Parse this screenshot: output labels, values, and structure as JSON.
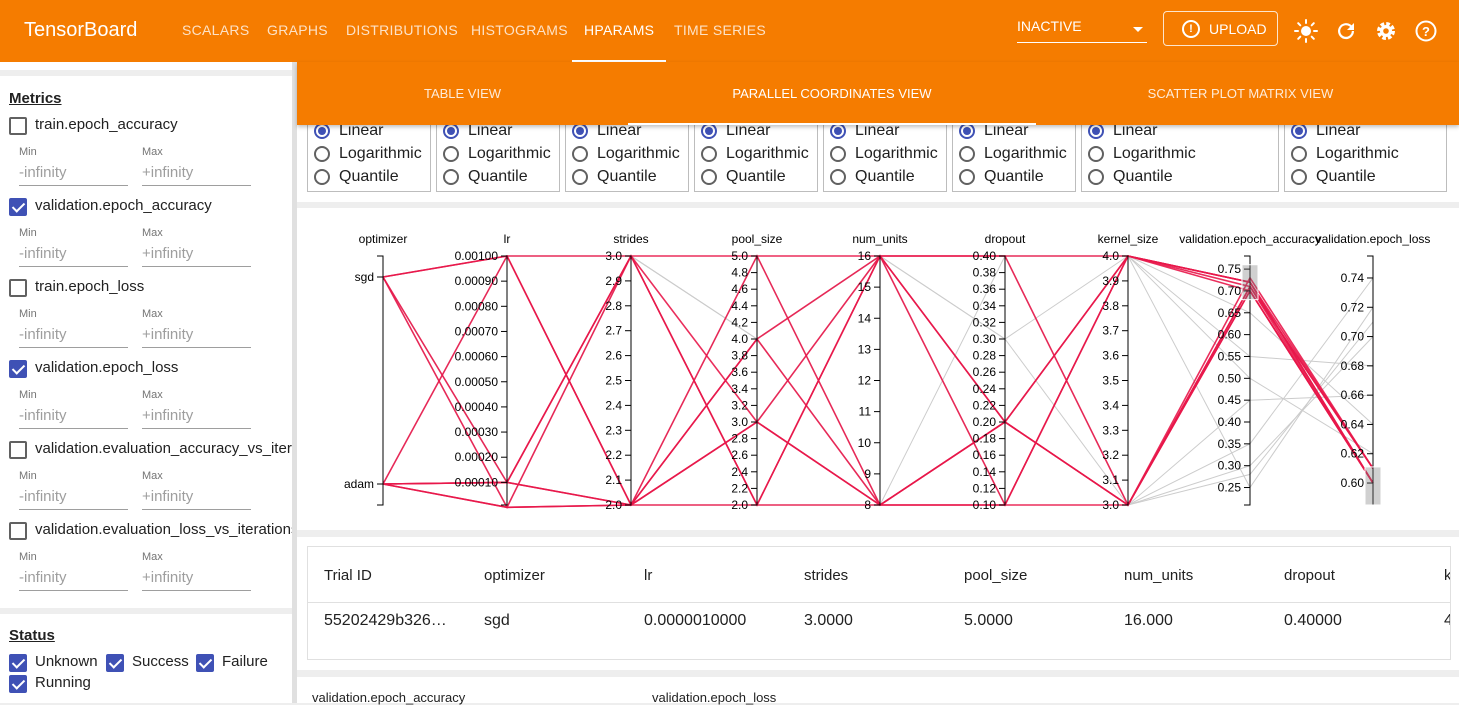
{
  "app": {
    "title": "TensorBoard",
    "nav": [
      "SCALARS",
      "GRAPHS",
      "DISTRIBUTIONS",
      "HISTOGRAMS",
      "HPARAMS",
      "TIME SERIES"
    ],
    "active_nav": "HPARAMS",
    "run_select": "INACTIVE",
    "upload_label": "UPLOAD",
    "toolbar_icons": [
      "brightness-icon",
      "refresh-icon",
      "settings-icon",
      "help-icon"
    ],
    "accent": "#f57c00"
  },
  "subtabs": [
    "TABLE VIEW",
    "PARALLEL COORDINATES VIEW",
    "SCATTER PLOT MATRIX VIEW"
  ],
  "active_subtab": "PARALLEL COORDINATES VIEW",
  "sidebar": {
    "metrics_title": "Metrics",
    "min_label": "Min",
    "max_label": "Max",
    "min_placeholder": "-infinity",
    "max_placeholder": "+infinity",
    "metrics": [
      {
        "label": "train.epoch_accuracy",
        "checked": false
      },
      {
        "label": "validation.epoch_accuracy",
        "checked": true
      },
      {
        "label": "train.epoch_loss",
        "checked": false
      },
      {
        "label": "validation.epoch_loss",
        "checked": true
      },
      {
        "label": "validation.evaluation_accuracy_vs_iterations",
        "checked": false
      },
      {
        "label": "validation.evaluation_loss_vs_iterations",
        "checked": false
      }
    ],
    "status_title": "Status",
    "statuses": [
      {
        "label": "Unknown",
        "checked": true
      },
      {
        "label": "Success",
        "checked": true
      },
      {
        "label": "Failure",
        "checked": true
      },
      {
        "label": "Running",
        "checked": true
      }
    ]
  },
  "scale_options": [
    "Linear",
    "Logarithmic",
    "Quantile"
  ],
  "selected_scale": "Linear",
  "chart_data": {
    "type": "parallel_coordinates",
    "axes": [
      {
        "name": "optimizer",
        "categorical": true,
        "ticks": [
          "sgd",
          "adam"
        ]
      },
      {
        "name": "lr",
        "ticks": [
          "0.00100",
          "0.00090",
          "0.00080",
          "0.00070",
          "0.00060",
          "0.00050",
          "0.00040",
          "0.00030",
          "0.00020",
          "0.00010"
        ],
        "range": [
          1e-05,
          0.001
        ]
      },
      {
        "name": "strides",
        "ticks": [
          "3.0",
          "2.9",
          "2.8",
          "2.7",
          "2.6",
          "2.5",
          "2.4",
          "2.3",
          "2.2",
          "2.1",
          "2.0"
        ],
        "range": [
          2,
          3
        ]
      },
      {
        "name": "pool_size",
        "ticks": [
          "5.0",
          "4.8",
          "4.6",
          "4.4",
          "4.2",
          "4.0",
          "3.8",
          "3.6",
          "3.4",
          "3.2",
          "3.0",
          "2.8",
          "2.6",
          "2.4",
          "2.2",
          "2.0"
        ],
        "range": [
          2,
          5
        ]
      },
      {
        "name": "num_units",
        "ticks": [
          "16",
          "15",
          "14",
          "13",
          "12",
          "11",
          "10",
          "9",
          "8"
        ],
        "range": [
          8,
          16
        ]
      },
      {
        "name": "dropout",
        "ticks": [
          "0.40",
          "0.38",
          "0.36",
          "0.34",
          "0.32",
          "0.30",
          "0.28",
          "0.26",
          "0.24",
          "0.22",
          "0.20",
          "0.18",
          "0.16",
          "0.14",
          "0.12",
          "0.10"
        ],
        "range": [
          0.1,
          0.4
        ]
      },
      {
        "name": "kernel_size",
        "ticks": [
          "4.0",
          "3.9",
          "3.8",
          "3.7",
          "3.6",
          "3.5",
          "3.4",
          "3.3",
          "3.2",
          "3.1",
          "3.0"
        ],
        "range": [
          3,
          4
        ]
      },
      {
        "name": "validation.epoch_accuracy",
        "ticks": [
          "0.75",
          "0.70",
          "0.65",
          "0.60",
          "0.55",
          "0.50",
          "0.45",
          "0.40",
          "0.35",
          "0.30",
          "0.25"
        ],
        "range": [
          0.21,
          0.78
        ]
      },
      {
        "name": "validation.epoch_loss",
        "ticks": [
          "0.74",
          "0.72",
          "0.70",
          "0.68",
          "0.66",
          "0.64",
          "0.62",
          "0.60"
        ],
        "range": [
          0.585,
          0.755
        ]
      }
    ],
    "highlighted_trials": [
      [
        "sgd",
        1e-06,
        3,
        5,
        16,
        0.4,
        4,
        0.71,
        0.61
      ],
      [
        "sgd",
        0.001,
        2,
        4,
        16,
        0.2,
        3,
        0.7,
        0.6
      ],
      [
        "adam",
        0.0001,
        3,
        3,
        8,
        0.1,
        4,
        0.72,
        0.6
      ],
      [
        "adam",
        0.0001,
        2,
        2,
        16,
        0.1,
        4,
        0.72,
        0.61
      ],
      [
        "adam",
        1e-06,
        2,
        4,
        8,
        0.2,
        3,
        0.71,
        0.6
      ],
      [
        "sgd",
        0.001,
        2,
        3,
        8,
        0.2,
        3,
        0.7,
        0.6
      ],
      [
        "adam",
        0.001,
        3,
        2,
        16,
        0.4,
        3,
        0.73,
        0.61
      ],
      [
        "sgd",
        0.0001,
        2,
        5,
        8,
        0.2,
        4,
        0.72,
        0.6
      ],
      [
        "adam",
        0.0001,
        3,
        2,
        8,
        0.1,
        3,
        0.71,
        0.61
      ],
      [
        "adam",
        1e-06,
        2,
        3,
        16,
        0.2,
        4,
        0.7,
        0.6
      ]
    ],
    "background_trials": [
      [
        "sgd",
        0.0001,
        3,
        4,
        16,
        0.3,
        3,
        0.3,
        0.7
      ],
      [
        "adam",
        1e-06,
        2,
        2,
        8,
        0.1,
        4,
        0.25,
        0.72
      ],
      [
        "sgd",
        0.001,
        3,
        4,
        16,
        0.4,
        4,
        0.55,
        0.68
      ],
      [
        "adam",
        0.0001,
        2,
        3,
        8,
        0.2,
        3,
        0.45,
        0.66
      ],
      [
        "sgd",
        1e-06,
        3,
        2,
        16,
        0.1,
        4,
        0.65,
        0.64
      ],
      [
        "adam",
        0.001,
        2,
        5,
        8,
        0.4,
        3,
        0.35,
        0.74
      ],
      [
        "sgd",
        0.0001,
        2,
        3,
        16,
        0.3,
        4,
        0.5,
        0.62
      ],
      [
        "adam",
        1e-06,
        3,
        4,
        8,
        0.2,
        3,
        0.28,
        0.71
      ]
    ],
    "highlight_color": "#e8174a",
    "background_color": "#cccccc",
    "brushed_axes": [
      "validation.epoch_accuracy",
      "validation.epoch_loss"
    ]
  },
  "table": {
    "headers": [
      "Trial ID",
      "optimizer",
      "lr",
      "strides",
      "pool_size",
      "num_units",
      "dropout",
      "k"
    ],
    "row": [
      "55202429b326…",
      "sgd",
      "0.0000010000",
      "3.0000",
      "5.0000",
      "16.000",
      "0.40000",
      "4"
    ]
  },
  "bottom_labels": [
    "validation.epoch_accuracy",
    "validation.epoch_loss"
  ]
}
